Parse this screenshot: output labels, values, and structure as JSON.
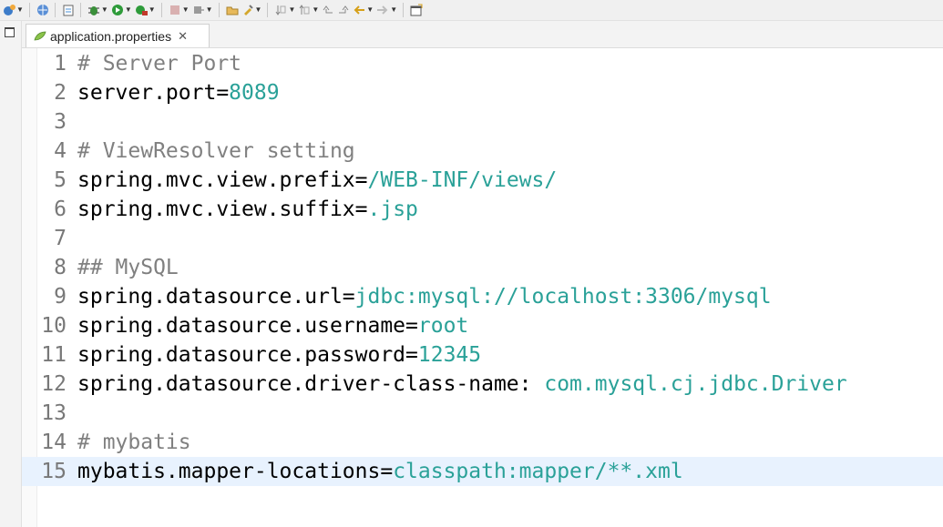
{
  "toolbar": {
    "icons": [
      "globe-gear-icon",
      "globe-icon",
      "clipboard-icon",
      "debug-icon",
      "run-icon",
      "external-tools-icon",
      "stop-icon",
      "build-icon",
      "open-folder-icon",
      "pin-icon",
      "next-annotation-icon",
      "previous-annotation-icon",
      "back-icon",
      "forward-icon",
      "back-nav-icon",
      "forward-nav-icon",
      "new-window-icon"
    ]
  },
  "tab": {
    "label": "application.properties",
    "close_glyph": "✕"
  },
  "editor": {
    "lines": [
      {
        "num": "1",
        "comment": "# Server Port"
      },
      {
        "num": "2",
        "key": "server.port=",
        "value": "8089"
      },
      {
        "num": "3"
      },
      {
        "num": "4",
        "comment": "# ViewResolver setting"
      },
      {
        "num": "5",
        "key": "spring.mvc.view.prefix=",
        "value": "/WEB-INF/views/"
      },
      {
        "num": "6",
        "key": "spring.mvc.view.suffix=",
        "value": ".jsp"
      },
      {
        "num": "7"
      },
      {
        "num": "8",
        "comment": "## MySQL"
      },
      {
        "num": "9",
        "key": "spring.datasource.url=",
        "value": "jdbc:mysql://localhost:3306/mysql"
      },
      {
        "num": "10",
        "key": "spring.datasource.username=",
        "value": "root"
      },
      {
        "num": "11",
        "key": "spring.datasource.password=",
        "value": "12345"
      },
      {
        "num": "12",
        "key": "spring.datasource.driver-class-name: ",
        "value": "com.mysql.cj.jdbc.Driver"
      },
      {
        "num": "13"
      },
      {
        "num": "14",
        "comment": "# mybatis"
      },
      {
        "num": "15",
        "key": "mybatis.mapper-locations=",
        "value": "classpath:mapper/**.xml",
        "current": true
      }
    ]
  },
  "colors": {
    "key": "#000000",
    "value": "#2aa198",
    "comment": "#808080",
    "current_line": "#e8f2fe"
  }
}
